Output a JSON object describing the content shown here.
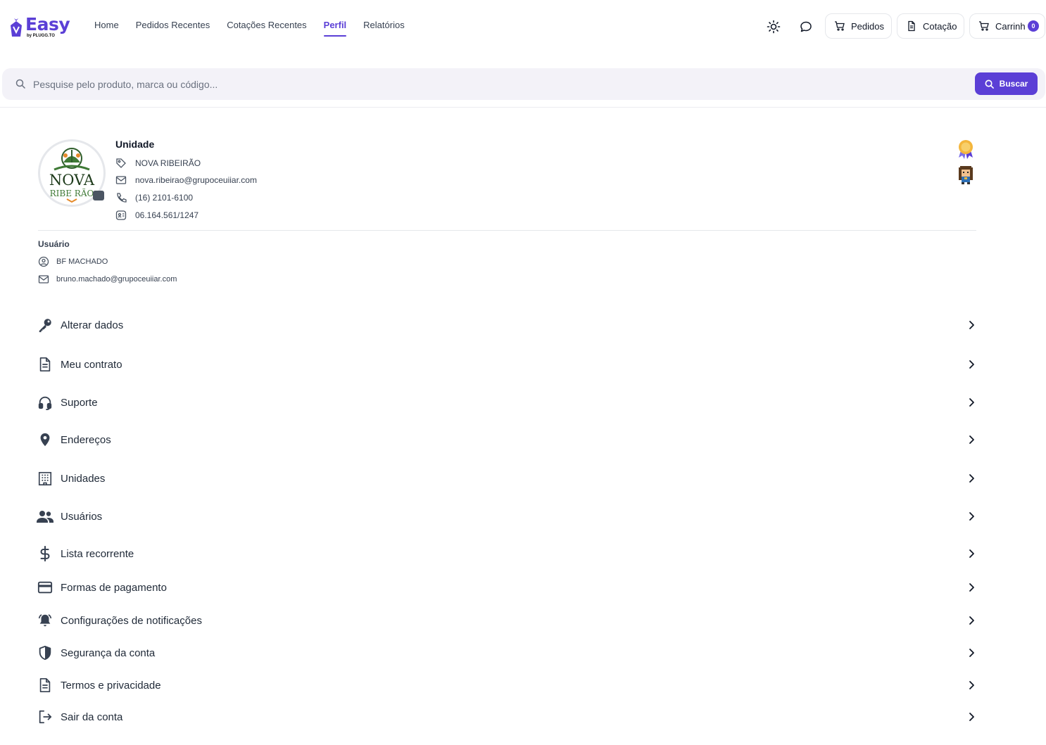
{
  "brand": {
    "name": "Easy",
    "sub": "by PLUGG.TO",
    "accent": "#5b3fd6"
  },
  "nav": {
    "items": [
      {
        "label": "Home"
      },
      {
        "label": "Pedidos Recentes"
      },
      {
        "label": "Cotações Recentes"
      },
      {
        "label": "Perfil",
        "active": true
      },
      {
        "label": "Relatórios"
      }
    ]
  },
  "header": {
    "pedidos_label": "Pedidos",
    "cotacao_label": "Cotação",
    "carrinho_label": "Carrinho",
    "cart_count": "0",
    "icons": [
      "sun-icon",
      "chat-icon",
      "cart-icon",
      "document-icon"
    ]
  },
  "search": {
    "placeholder": "Pesquise pelo produto, marca ou código...",
    "value": "",
    "button_label": "Buscar"
  },
  "unit": {
    "title": "Unidade",
    "name": "NOVA RIBEIRÃO",
    "email": "nova.ribeirao@grupoceuiiar.com",
    "phone": "(16) 2101-6100",
    "document": "06.164.561/1247",
    "avatar_logo_text": [
      "NOVA",
      "RIBE RÃO"
    ]
  },
  "user": {
    "title": "Usuário",
    "name": "BF MACHADO",
    "email": "bruno.machado@grupoceuiiar.com"
  },
  "menu": [
    {
      "label": "Alterar dados",
      "icon": "key-icon"
    },
    {
      "label": "Meu contrato",
      "icon": "document-icon"
    },
    {
      "label": "Suporte",
      "icon": "headset-icon"
    },
    {
      "label": "Endereços",
      "icon": "location-pin-icon"
    },
    {
      "label": "Unidades",
      "icon": "building-icon"
    },
    {
      "label": "Usuários",
      "icon": "users-icon"
    },
    {
      "label": "Lista recorrente",
      "icon": "dollar-icon"
    },
    {
      "label": "Formas de pagamento",
      "icon": "credit-card-icon"
    },
    {
      "label": "Configurações de notificações",
      "icon": "bell-icon"
    },
    {
      "label": "Segurança da conta",
      "icon": "shield-icon"
    },
    {
      "label": "Termos e privacidade",
      "icon": "document-icon"
    },
    {
      "label": "Sair da conta",
      "icon": "logout-icon"
    }
  ]
}
